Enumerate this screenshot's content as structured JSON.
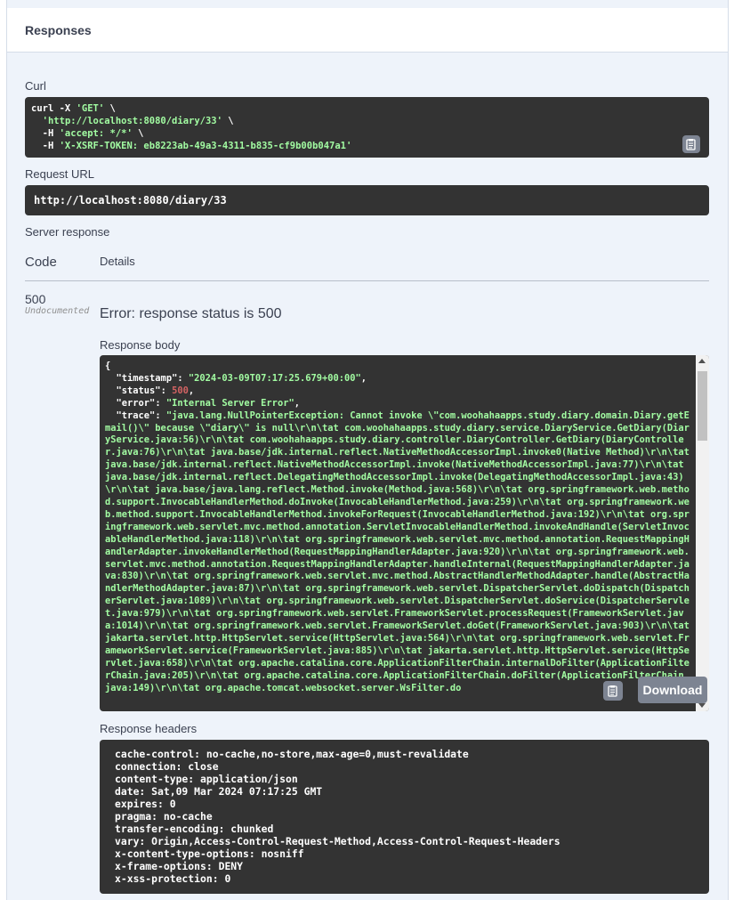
{
  "responses": {
    "title": "Responses"
  },
  "curl": {
    "label": "Curl",
    "line1_prefix": "curl -X ",
    "line1_method": "'GET'",
    "line1_suffix": " \\",
    "line2_url": "'http://localhost:8080/diary/33'",
    "line2_suffix": " \\",
    "line3_prefix": "  -H ",
    "line3_header": "'accept: */*'",
    "line3_suffix": " \\",
    "line4_prefix": "  -H ",
    "line4_header": "'X-XSRF-TOKEN: eb8223ab-49a3-4311-b835-cf9b00b047a1'"
  },
  "request_url": {
    "label": "Request URL",
    "value": "http://localhost:8080/diary/33"
  },
  "server_response": {
    "label": "Server response",
    "code_header": "Code",
    "details_header": "Details",
    "status_code": "500",
    "undocumented": "Undocumented",
    "error_text": "Error: response status is 500"
  },
  "response_body": {
    "label": "Response body",
    "open_brace": "{",
    "timestamp_key": "\"timestamp\"",
    "timestamp_val": "\"2024-03-09T07:17:25.679+00:00\"",
    "status_key": "\"status\"",
    "status_val": "500",
    "error_key": "\"error\"",
    "error_val": "\"Internal Server Error\"",
    "trace_key": "\"trace\"",
    "trace_val": "\"java.lang.NullPointerException: Cannot invoke \\\"com.woohahaapps.study.diary.domain.Diary.getEmail()\\\" because \\\"diary\\\" is null\\r\\n\\tat com.woohahaapps.study.diary.service.DiaryService.GetDiary(DiaryService.java:56)\\r\\n\\tat com.woohahaapps.study.diary.controller.DiaryController.GetDiary(DiaryController.java:76)\\r\\n\\tat java.base/jdk.internal.reflect.NativeMethodAccessorImpl.invoke0(Native Method)\\r\\n\\tat java.base/jdk.internal.reflect.NativeMethodAccessorImpl.invoke(NativeMethodAccessorImpl.java:77)\\r\\n\\tat java.base/jdk.internal.reflect.DelegatingMethodAccessorImpl.invoke(DelegatingMethodAccessorImpl.java:43)\\r\\n\\tat java.base/java.lang.reflect.Method.invoke(Method.java:568)\\r\\n\\tat org.springframework.web.method.support.InvocableHandlerMethod.doInvoke(InvocableHandlerMethod.java:259)\\r\\n\\tat org.springframework.web.method.support.InvocableHandlerMethod.invokeForRequest(InvocableHandlerMethod.java:192)\\r\\n\\tat org.springframework.web.servlet.mvc.method.annotation.ServletInvocableHandlerMethod.invokeAndHandle(ServletInvocableHandlerMethod.java:118)\\r\\n\\tat org.springframework.web.servlet.mvc.method.annotation.RequestMappingHandlerAdapter.invokeHandlerMethod(RequestMappingHandlerAdapter.java:920)\\r\\n\\tat org.springframework.web.servlet.mvc.method.annotation.RequestMappingHandlerAdapter.handleInternal(RequestMappingHandlerAdapter.java:830)\\r\\n\\tat org.springframework.web.servlet.mvc.method.AbstractHandlerMethodAdapter.handle(AbstractHandlerMethodAdapter.java:87)\\r\\n\\tat org.springframework.web.servlet.DispatcherServlet.doDispatch(DispatcherServlet.java:1089)\\r\\n\\tat org.springframework.web.servlet.DispatcherServlet.doService(DispatcherServlet.java:979)\\r\\n\\tat org.springframework.web.servlet.FrameworkServlet.processRequest(FrameworkServlet.java:1014)\\r\\n\\tat org.springframework.web.servlet.FrameworkServlet.doGet(FrameworkServlet.java:903)\\r\\n\\tat jakarta.servlet.http.HttpServlet.service(HttpServlet.java:564)\\r\\n\\tat org.springframework.web.servlet.FrameworkServlet.service(FrameworkServlet.java:885)\\r\\n\\tat jakarta.servlet.http.HttpServlet.service(HttpServlet.java:658)\\r\\n\\tat org.apache.catalina.core.ApplicationFilterChain.internalDoFilter(ApplicationFilterChain.java:205)\\r\\n\\tat org.apache.catalina.core.ApplicationFilterChain.doFilter(ApplicationFilterChain.java:149)\\r\\n\\tat org.apache.tomcat.websocket.server.WsFilter.do",
    "download_label": "Download"
  },
  "response_headers": {
    "label": "Response headers",
    "lines": [
      "cache-control: no-cache,no-store,max-age=0,must-revalidate",
      "connection: close",
      "content-type: application/json",
      "date: Sat,09 Mar 2024 07:17:25 GMT",
      "expires: 0",
      "pragma: no-cache",
      "transfer-encoding: chunked",
      "vary: Origin,Access-Control-Request-Method,Access-Control-Request-Headers",
      "x-content-type-options: nosniff",
      "x-frame-options: DENY",
      "x-xss-protection: 0"
    ]
  },
  "icons": {
    "copy": "clipboard-icon"
  }
}
